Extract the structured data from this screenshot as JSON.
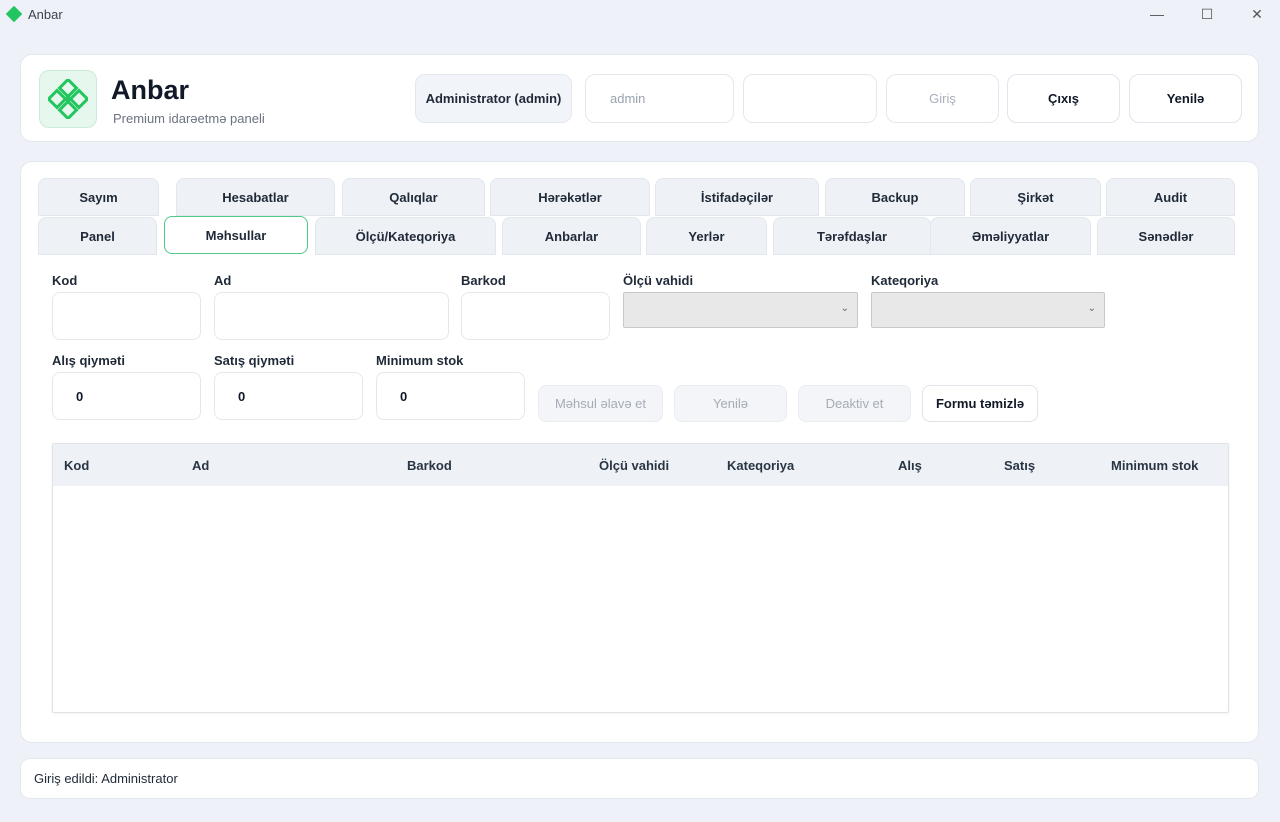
{
  "window": {
    "title": "Anbar",
    "controls": {
      "minimize": "—",
      "maximize": "☐",
      "close": "✕"
    }
  },
  "header": {
    "brand_title": "Anbar",
    "brand_subtitle": "Premium idarəetmə paneli",
    "user_badge": "Administrator (admin)",
    "username_value": "admin",
    "password_value": "",
    "login_label": "Giriş",
    "logout_label": "Çıxış",
    "refresh_label": "Yenilə"
  },
  "tabs_row1": [
    "Sayım",
    "Hesabatlar",
    "Qalıqlar",
    "Hərəkətlər",
    "İstifadəçilər",
    "Backup",
    "Şirkət",
    "Audit"
  ],
  "tabs_row2": [
    "Panel",
    "Məhsullar",
    "Ölçü/Kateqoriya",
    "Anbarlar",
    "Yerlər",
    "Tərəfdaşlar",
    "Əməliyyatlar",
    "Sənədlər"
  ],
  "active_tab": "Məhsullar",
  "form": {
    "kod": {
      "label": "Kod",
      "value": ""
    },
    "ad": {
      "label": "Ad",
      "value": ""
    },
    "barkod": {
      "label": "Barkod",
      "value": ""
    },
    "olcu_vahidi": {
      "label": "Ölçü vahidi",
      "value": ""
    },
    "kateqoriya": {
      "label": "Kateqoriya",
      "value": ""
    },
    "alis_qiymeti": {
      "label": "Alış qiyməti",
      "value": "0"
    },
    "satis_qiymeti": {
      "label": "Satış qiyməti",
      "value": "0"
    },
    "minimum_stok": {
      "label": "Minimum stok",
      "value": "0"
    }
  },
  "actions": {
    "add_product": "Məhsul əlavə et",
    "update": "Yenilə",
    "deactivate": "Deaktiv et",
    "clear_form": "Formu təmizlə"
  },
  "table": {
    "columns": [
      "Kod",
      "Ad",
      "Barkod",
      "Ölçü vahidi",
      "Kateqoriya",
      "Alış",
      "Satış",
      "Minimum stok"
    ],
    "rows": []
  },
  "status": {
    "text": "Giriş edildi: Administrator"
  },
  "colors": {
    "accent": "#4fc98a",
    "logo_green": "#22c55e",
    "background": "#eef2f8"
  }
}
